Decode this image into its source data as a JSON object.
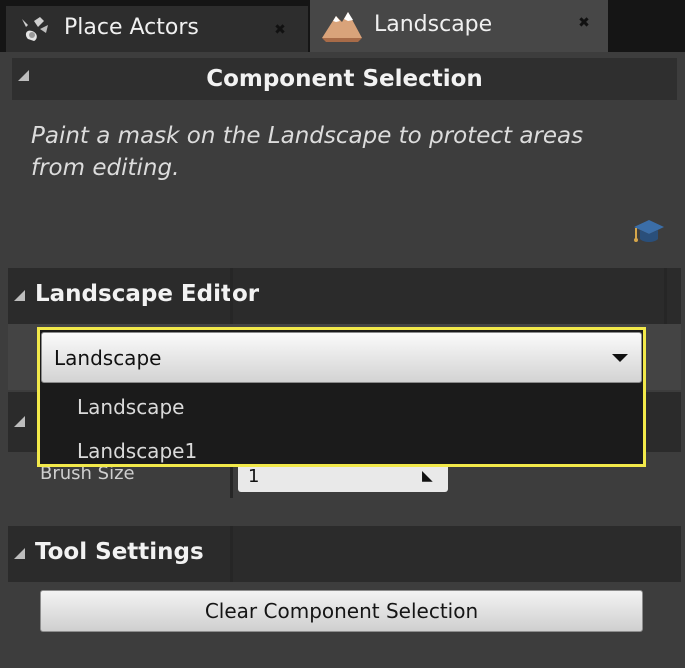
{
  "tabs": [
    {
      "label": "Place Actors",
      "icon": "place-actors-icon",
      "active": false
    },
    {
      "label": "Landscape",
      "icon": "landscape-mountain-icon",
      "active": true
    }
  ],
  "component_selection": {
    "title": "Component Selection",
    "description": "Paint a mask on the Landscape to protect areas from editing."
  },
  "landscape_editor": {
    "title": "Landscape Editor",
    "selected_landscape": "Landscape",
    "options": [
      "Landscape",
      "Landscape1"
    ]
  },
  "brush": {
    "label": "Brush Size",
    "value": "1"
  },
  "tool_settings": {
    "title": "Tool Settings",
    "clear_button_label": "Clear Component Selection"
  },
  "colors": {
    "highlight": "#f2e94a",
    "panel_bg": "#3d3d3d",
    "header_bg": "#2b2b2b"
  }
}
